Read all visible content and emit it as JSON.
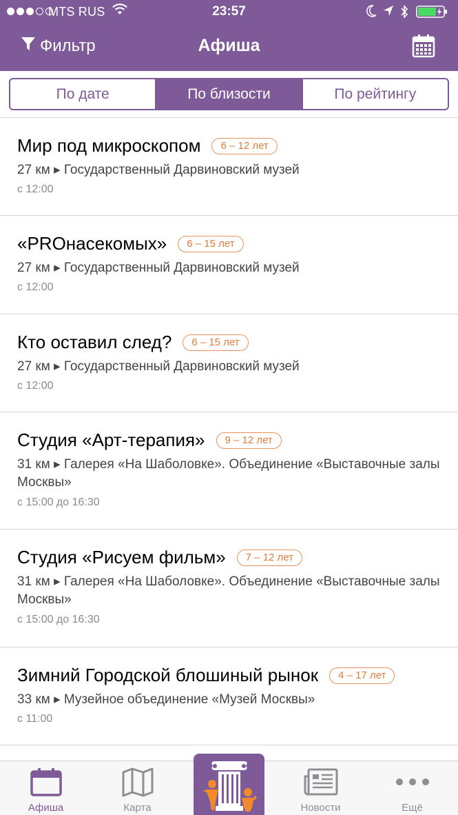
{
  "status_bar": {
    "carrier": "MTS RUS",
    "time": "23:57"
  },
  "nav": {
    "filter_label": "Фильтр",
    "title": "Афиша"
  },
  "segments": [
    {
      "label": "По дате",
      "active": false
    },
    {
      "label": "По близости",
      "active": true
    },
    {
      "label": "По рейтингу",
      "active": false
    }
  ],
  "events": [
    {
      "title": "Мир под микроскопом",
      "age": "6 – 12 лет",
      "place": "27 км ▸ Государственный Дарвиновский музей",
      "time": "с 12:00"
    },
    {
      "title": "«PROнасекомых»",
      "age": "6 – 15 лет",
      "place": "27 км ▸ Государственный Дарвиновский музей",
      "time": "с 12:00"
    },
    {
      "title": "Кто оставил след?",
      "age": "6 – 15 лет",
      "place": "27 км ▸ Государственный Дарвиновский музей",
      "time": "с 12:00"
    },
    {
      "title": "Студия «Арт-терапия»",
      "age": "9 – 12 лет",
      "place": "31 км ▸ Галерея «На Шаболовке». Объединение «Выставочные залы Москвы»",
      "time": "с 15:00 до 16:30"
    },
    {
      "title": "Студия «Рисуем фильм»",
      "age": "7 – 12 лет",
      "place": "31 км ▸ Галерея «На Шаболовке». Объединение «Выставочные залы Москвы»",
      "time": "с 15:00 до 16:30"
    },
    {
      "title": "Зимний Городской блошиный рынок",
      "age": "4 – 17 лет",
      "place": "33 км ▸ Музейное объединение «Музей Москвы»",
      "time": "с 11:00"
    }
  ],
  "tabs": {
    "afisha": "Афиша",
    "map": "Карта",
    "news": "Новости",
    "more": "Ещё"
  },
  "colors": {
    "brand": "#7e5a98",
    "age_badge": "#e07c3c",
    "battery": "#4cd964"
  },
  "icons": [
    "filter-icon",
    "calendar-icon",
    "map-icon",
    "museum-icon",
    "news-icon",
    "more-icon"
  ]
}
